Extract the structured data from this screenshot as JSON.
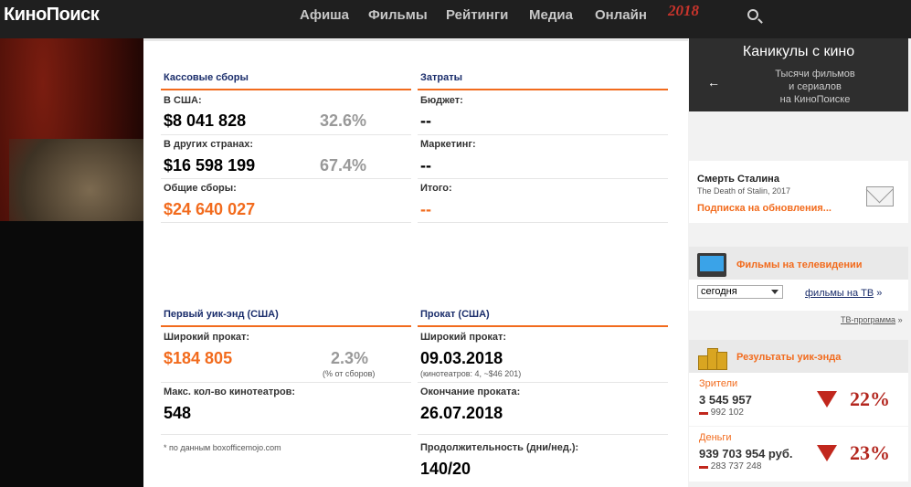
{
  "header": {
    "logo": "КиноПоиск",
    "nav": [
      "Афиша",
      "Фильмы",
      "Рейтинги",
      "Медиа",
      "Онлайн"
    ],
    "nav_badge": "2018"
  },
  "box_office": {
    "title": "Кассовые сборы",
    "usa_label": "В США:",
    "usa_value": "$8 041 828",
    "usa_pct": "32.6%",
    "other_label": "В других странах:",
    "other_value": "$16 598 199",
    "other_pct": "67.4%",
    "total_label": "Общие сборы:",
    "total_value": "$24 640 027"
  },
  "costs": {
    "title": "Затраты",
    "budget_label": "Бюджет:",
    "budget_value": "--",
    "marketing_label": "Маркетинг:",
    "marketing_value": "--",
    "total_label": "Итого:",
    "total_value": "--"
  },
  "first_weekend": {
    "title": "Первый уик-энд (США)",
    "wide_label": "Широкий прокат:",
    "wide_value": "$184 805",
    "wide_pct": "2.3%",
    "wide_note": "(% от сборов)",
    "max_label": "Макс. кол-во кинотеатров:",
    "max_value": "548",
    "source_note": "* по данным boxofficemojo.com"
  },
  "release": {
    "title": "Прокат (США)",
    "wide_label": "Широкий прокат:",
    "wide_value": "09.03.2018",
    "wide_note": "(кинотеатров: 4, ~$46 201)",
    "end_label": "Окончание проката:",
    "end_value": "26.07.2018",
    "duration_label": "Продолжительность (дни/нед.):",
    "duration_value": "140/20"
  },
  "sidebar": {
    "banner_title": "Каникулы с кино",
    "banner_sub1": "Тысячи фильмов",
    "banner_sub2": "и сериалов",
    "banner_sub3": "на КиноПоиске",
    "banner_arrow": "←",
    "subscribe_title": "Смерть Сталина",
    "subscribe_sub": "The Death of Stalin, 2017",
    "subscribe_link": "Подписка на обновления...",
    "tv_title": "Фильмы на телевидении",
    "tv_select": "сегодня",
    "tv_link": "фильмы на ТВ",
    "tv_link_suffix": "»",
    "tv_program": "ТВ-программа",
    "tv_program_suffix": "»",
    "weekend_title": "Результаты уик-энда",
    "viewers_label": "Зрители",
    "viewers_value": "3 545 957",
    "viewers_delta": "992 102",
    "viewers_pct": "22%",
    "money_label": "Деньги",
    "money_value": "939 703 954 руб.",
    "money_delta": "283 737 248",
    "money_pct": "23%"
  }
}
